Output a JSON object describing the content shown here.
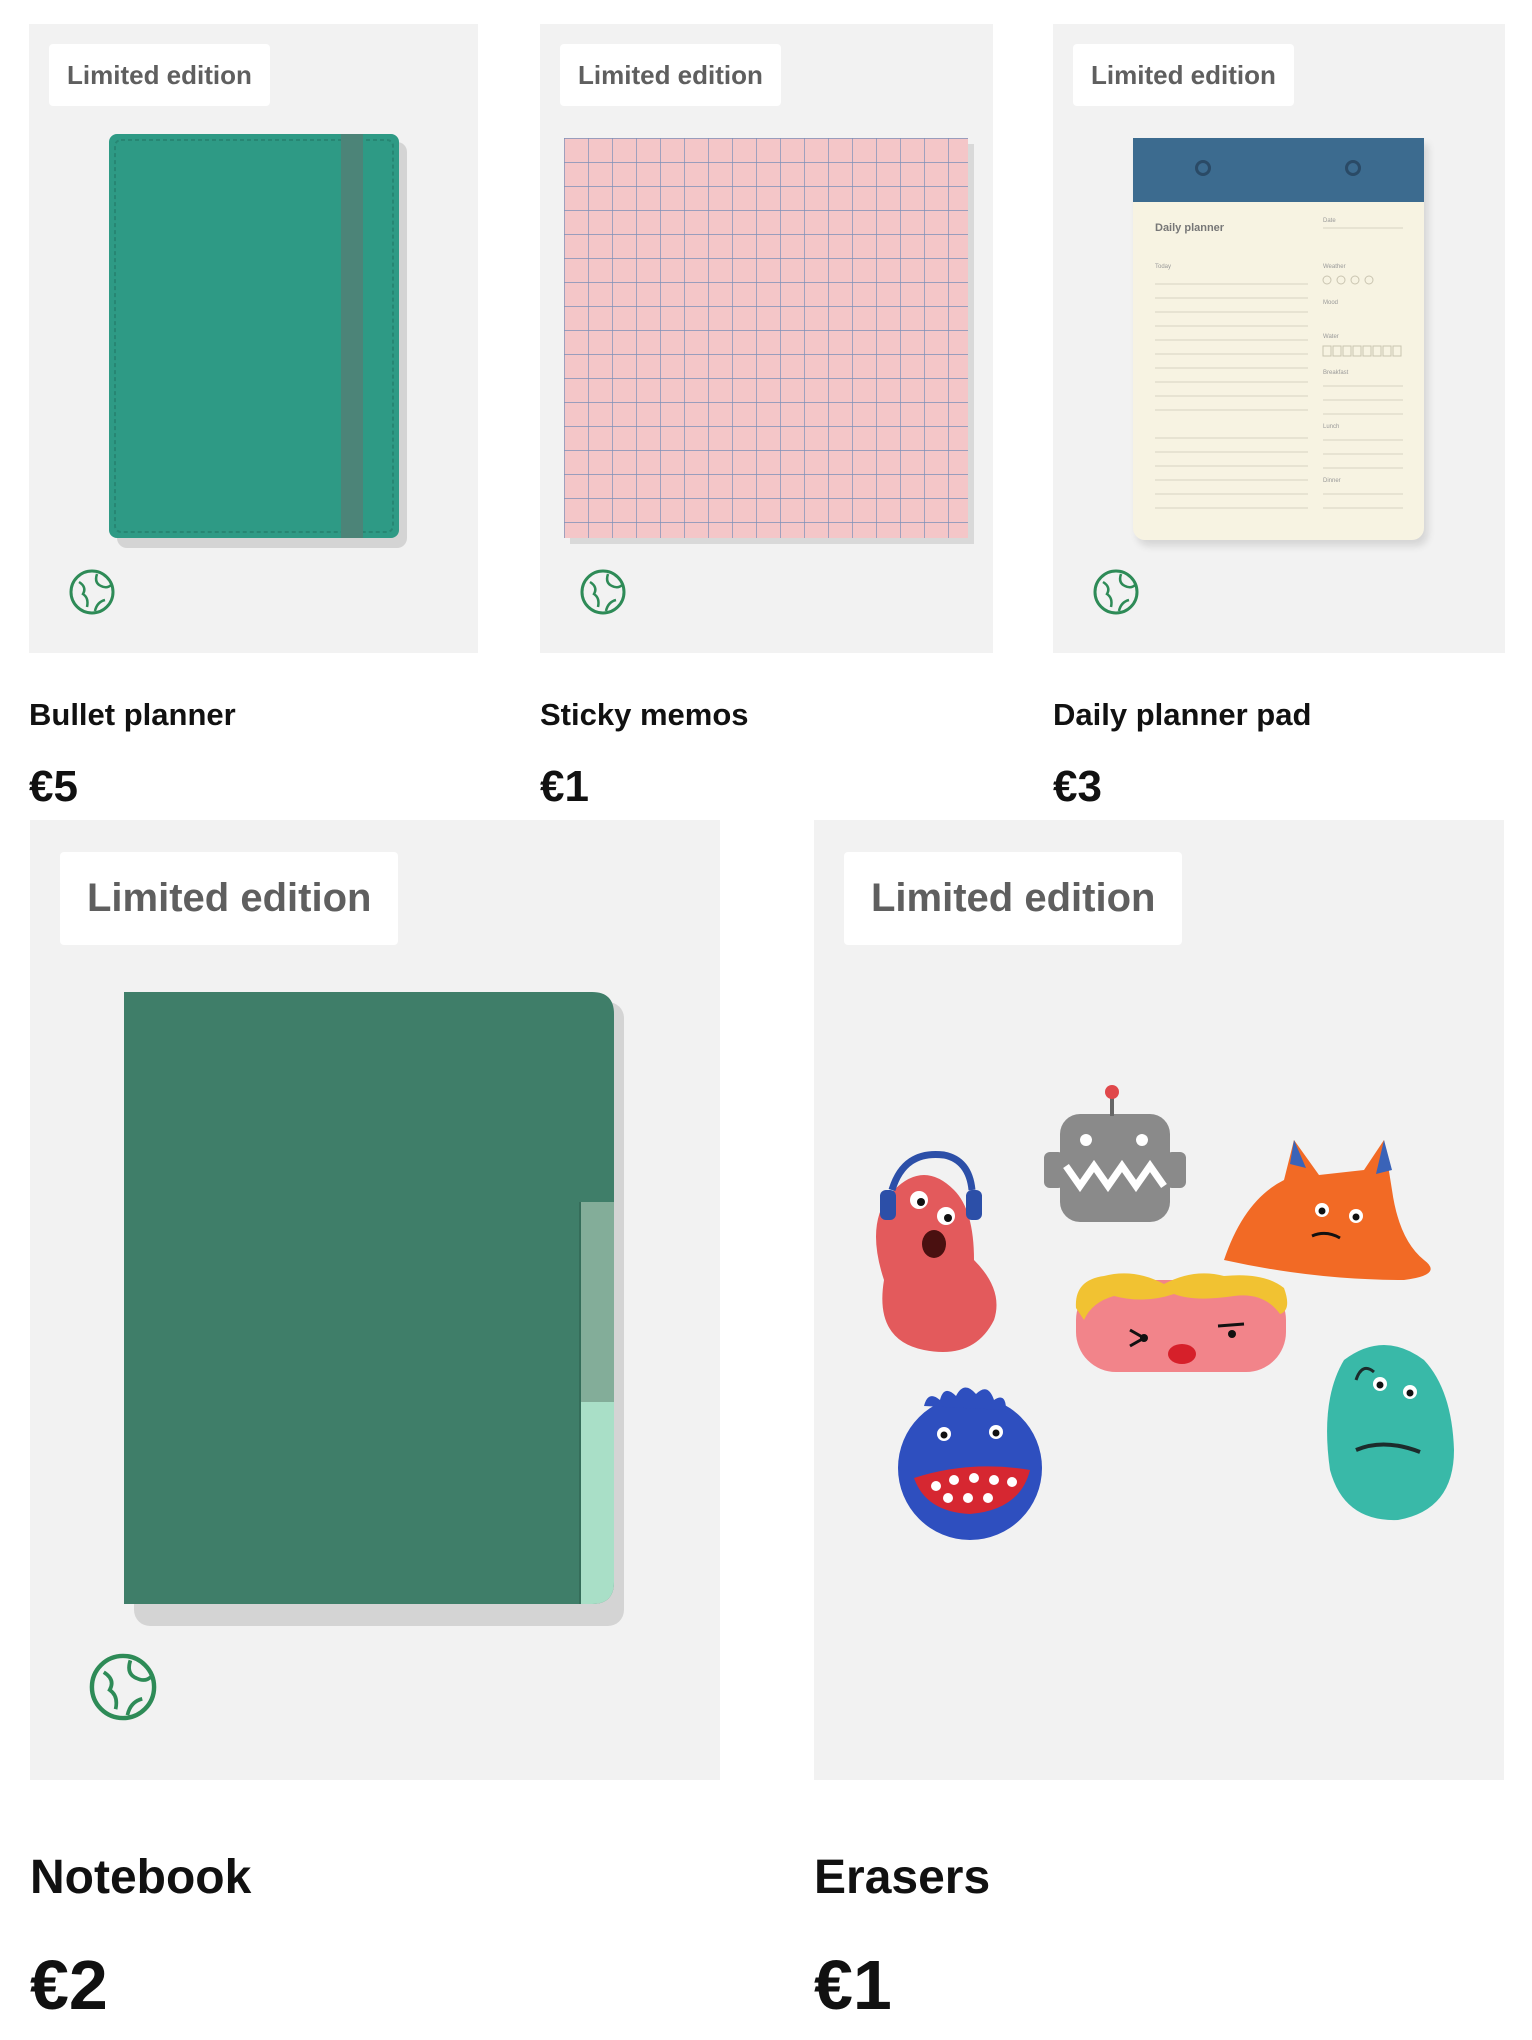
{
  "products": [
    {
      "badge": "Limited edition",
      "name": "Bullet planner",
      "price": "€5",
      "eco_icon": "globe-leaf-icon"
    },
    {
      "badge": "Limited edition",
      "name": "Sticky memos",
      "price": "€1",
      "eco_icon": "globe-leaf-icon"
    },
    {
      "badge": "Limited edition",
      "name": "Daily planner pad",
      "price": "€3",
      "eco_icon": "globe-leaf-icon"
    },
    {
      "badge": "Limited edition",
      "name": "Notebook",
      "price": "€2",
      "eco_icon": "globe-leaf-icon"
    },
    {
      "badge": "Limited edition",
      "name": "Erasers",
      "price": "€1"
    }
  ],
  "daily_planner": {
    "title": "Daily planner",
    "fields": [
      "Date",
      "Weather",
      "Mood",
      "Water",
      "Breakfast",
      "Lunch",
      "Dinner",
      "Today"
    ]
  },
  "colors": {
    "card_bg": "#f2f2f2",
    "badge_text": "#5f5f5f",
    "eco_green": "#2e8b57",
    "bullet_planner": "#2e9a85",
    "notebook": "#3f7e69",
    "sticky_pink": "#f4c6c8",
    "planner_header": "#3c6b8f"
  }
}
